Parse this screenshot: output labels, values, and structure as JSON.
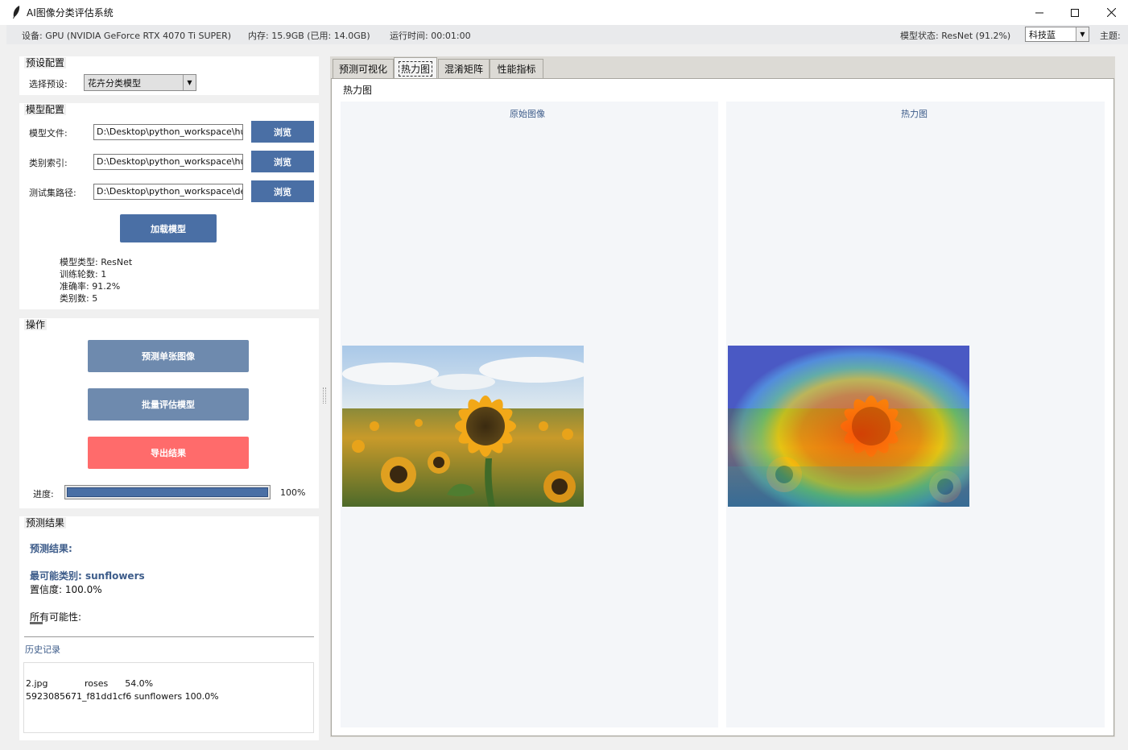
{
  "window": {
    "title": "AI图像分类评估系统"
  },
  "status": {
    "device": "设备: GPU (NVIDIA GeForce RTX 4070 Ti SUPER)",
    "memory": "内存: 15.9GB (已用: 14.0GB)",
    "runtime": "运行时间: 00:01:00",
    "model_state": "模型状态: ResNet (91.2%)",
    "theme_value": "科技蓝",
    "theme_label": "主题:"
  },
  "preset": {
    "section": "预设配置",
    "label": "选择预设:",
    "value": "花卉分类模型"
  },
  "model_config": {
    "section": "模型配置",
    "fields": [
      {
        "label": "模型文件:",
        "value": "D:\\Desktop\\python_workspace\\hu",
        "button": "浏览"
      },
      {
        "label": "类别索引:",
        "value": "D:\\Desktop\\python_workspace\\hu",
        "button": "浏览"
      },
      {
        "label": "测试集路径:",
        "value": "D:\\Desktop\\python_workspace\\de",
        "button": "浏览"
      }
    ],
    "load_button": "加载模型",
    "info": {
      "type": "模型类型: ResNet",
      "epochs": "训练轮数: 1",
      "accuracy": "准确率: 91.2%",
      "classes": "类别数: 5"
    }
  },
  "operations": {
    "section": "操作",
    "predict_button": "预测单张图像",
    "batch_button": "批量评估模型",
    "export_button": "导出结果",
    "progress_label": "进度:",
    "progress_value": 1.0,
    "progress_text": "100%"
  },
  "prediction": {
    "section": "预测结果",
    "heading": "预测结果:",
    "top_class": "最可能类别: sunflowers",
    "confidence": "置信度: 100.0%",
    "all_label": "所有可能性:"
  },
  "history": {
    "label": "历史记录",
    "rows": [
      "2.jpg             roses      54.0%",
      "5923085671_f81dd1cf6 sunflowers 100.0%"
    ]
  },
  "tabs": [
    "预测可视化",
    "热力图",
    "混淆矩阵",
    "性能指标"
  ],
  "heatmap": {
    "section": "热力图",
    "original_caption": "原始图像",
    "heatmap_caption": "热力图"
  },
  "colors": {
    "accent": "#4a6fa5",
    "export": "#ff6b6b",
    "muted_button": "#6e8aae"
  }
}
